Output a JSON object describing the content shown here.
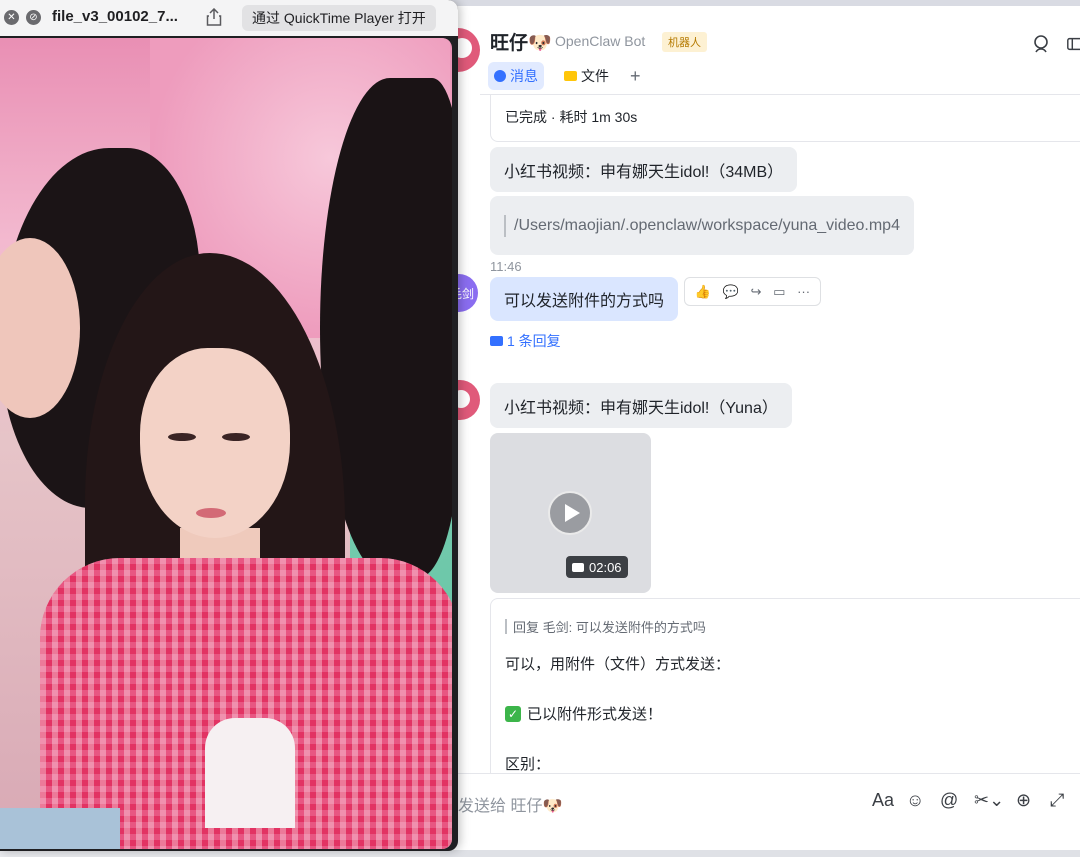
{
  "player": {
    "title": "file_v3_00102_7...",
    "open_button": "通过 QuickTime Player 打开",
    "close_glyph": "✕",
    "disable_glyph": "⊘"
  },
  "chat": {
    "header": {
      "title": "旺仔🐶",
      "subtitle": "OpenClaw Bot",
      "badge": "机器人"
    },
    "tabs": [
      {
        "label": "消息"
      },
      {
        "label": "文件"
      },
      {
        "label": "+"
      }
    ],
    "messages": {
      "status": "已完成 · 耗时 1m 30s",
      "file_title": "小红书视频：申有娜天生idol!（34MB）",
      "file_path": "/Users/maojian/.openclaw/workspace/yuna_video.mp4",
      "timestamp": "11:46",
      "user_avatar_text": "毛剑",
      "user_message": "可以发送附件的方式吗",
      "reply_count": "1 条回复",
      "video_title": "小红书视频：申有娜天生idol!（Yuna）",
      "video_duration": "02:06",
      "reply_quote": "回复 毛剑: 可以发送附件的方式吗",
      "reply_line1": "可以，用附件（文件）方式发送：",
      "reply_line2": "已以附件形式发送！",
      "reply_line3": "区别："
    },
    "actions": [
      "👍",
      "💬",
      "↪",
      "▭",
      "···"
    ],
    "composer": {
      "placeholder": "发送给 旺仔🐶",
      "tools": [
        "Aa",
        "☺",
        "@",
        "✂⌄",
        "⊕",
        "⤢"
      ]
    }
  }
}
